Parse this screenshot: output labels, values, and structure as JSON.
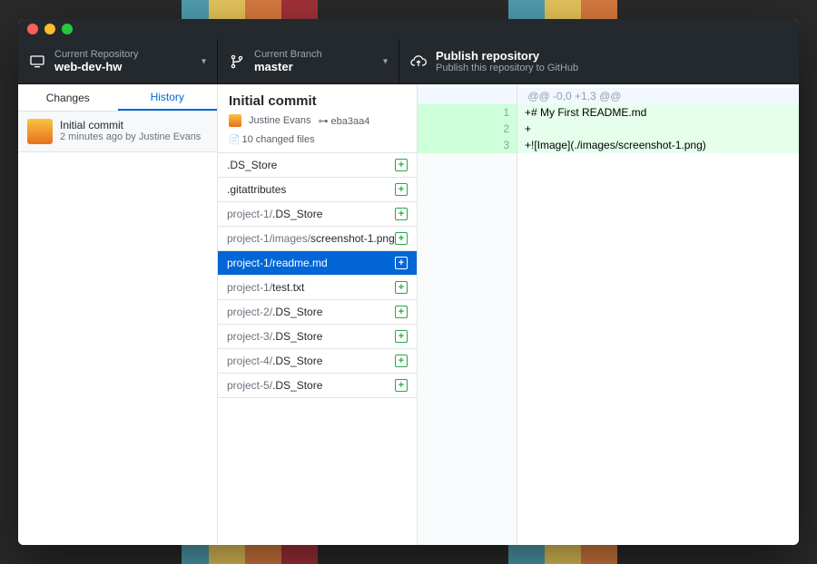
{
  "toolbar": {
    "repo": {
      "label": "Current Repository",
      "value": "web-dev-hw"
    },
    "branch": {
      "label": "Current Branch",
      "value": "master"
    },
    "publish": {
      "title": "Publish repository",
      "subtitle": "Publish this repository to GitHub"
    }
  },
  "tabs": {
    "changes": "Changes",
    "history": "History"
  },
  "history_item": {
    "title": "Initial commit",
    "meta": "2 minutes ago by Justine Evans"
  },
  "commit": {
    "title": "Initial commit",
    "author": "Justine Evans",
    "sha": "eba3aa4",
    "files_label": "10 changed files"
  },
  "files": [
    {
      "prefix": "",
      "name": ".DS_Store",
      "selected": false
    },
    {
      "prefix": "",
      "name": ".gitattributes",
      "selected": false
    },
    {
      "prefix": "project-1/",
      "name": ".DS_Store",
      "selected": false
    },
    {
      "prefix": "project-1/images/",
      "name": "screenshot-1.png",
      "selected": false
    },
    {
      "prefix": "project-1/",
      "name": "readme.md",
      "selected": true
    },
    {
      "prefix": "project-1/",
      "name": "test.txt",
      "selected": false
    },
    {
      "prefix": "project-2/",
      "name": ".DS_Store",
      "selected": false
    },
    {
      "prefix": "project-3/",
      "name": ".DS_Store",
      "selected": false
    },
    {
      "prefix": "project-4/",
      "name": ".DS_Store",
      "selected": false
    },
    {
      "prefix": "project-5/",
      "name": ".DS_Store",
      "selected": false
    }
  ],
  "diff": {
    "hunk": "@@ -0,0 +1,3 @@",
    "lines": [
      {
        "n": "1",
        "text": "+# My First README.md"
      },
      {
        "n": "2",
        "text": "+"
      },
      {
        "n": "3",
        "text": "+![Image](./images/screenshot-1.png)"
      }
    ]
  }
}
